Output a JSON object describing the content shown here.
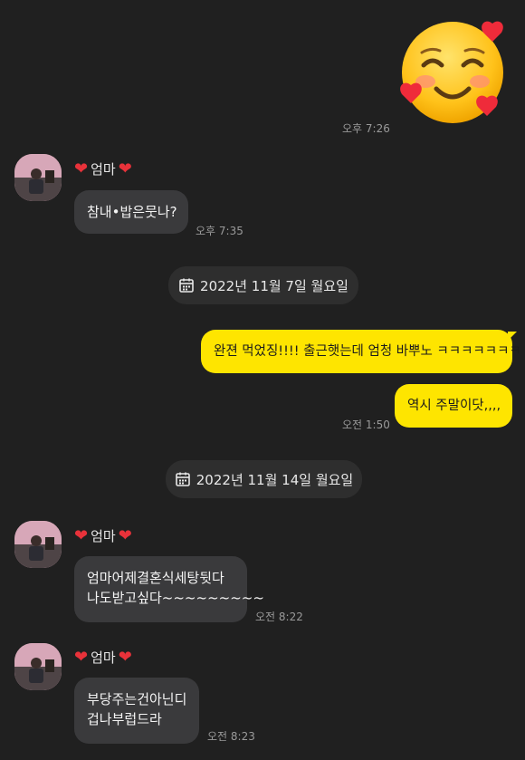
{
  "messages": {
    "sticker": {
      "name": "smiling-face-with-hearts-emoji",
      "time": "오후 7:26"
    },
    "msg1": {
      "sender": "엄마",
      "text": "참내•밥은뭇나?",
      "time": "오후 7:35"
    },
    "date1": {
      "label": "2022년 11월 7일 월요일",
      "icon": "calendar-icon"
    },
    "reply1": {
      "text": "완젼 먹었징!!!! 출근햇는데 엄청 바뿌노 ㅋㅋㅋㅋㅋㅋㅋ"
    },
    "reply2": {
      "text": "역시 주말이닷,,,,",
      "time": "오전 1:50"
    },
    "date2": {
      "label": "2022년 11월 14일 월요일",
      "icon": "calendar-icon"
    },
    "msg2": {
      "sender": "엄마",
      "line1": "엄마어제결혼식세탕뒷다",
      "line2": "나도받고싶다~~~~~~~~~",
      "time": "오전 8:22"
    },
    "msg3": {
      "sender": "엄마",
      "line1": "부당주는건아닌디",
      "line2": "겁나부럽드라",
      "time": "오전 8:23"
    }
  },
  "colors": {
    "background": "#202020",
    "incoming_bubble": "#3a3a3c",
    "outgoing_bubble": "#fee500",
    "heart": "#e8323a",
    "timestamp": "#9a9a9a"
  }
}
